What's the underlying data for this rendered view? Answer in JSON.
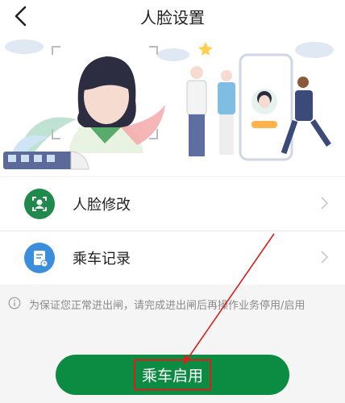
{
  "header": {
    "title": "人脸设置",
    "back_icon": "back-chevron-icon"
  },
  "menu": {
    "items": [
      {
        "label": "人脸修改",
        "icon": "face-scan-icon"
      },
      {
        "label": "乘车记录",
        "icon": "ride-record-icon"
      }
    ]
  },
  "notice": {
    "text": "为保证您正常进出闸，请完成进出闸后再操作业务停用/启用",
    "icon": "info-icon"
  },
  "primary_button": {
    "label": "乘车启用"
  },
  "colors": {
    "accent_green": "#0c8c42",
    "annotation_red": "#d62020"
  }
}
